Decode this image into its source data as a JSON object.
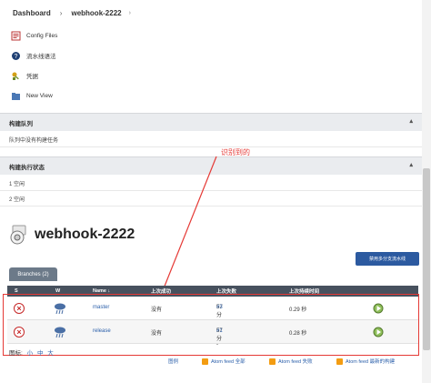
{
  "breadcrumb": {
    "home": "Dashboard",
    "sep": "›",
    "project": "webhook-2222",
    "chevron": "›"
  },
  "sidebar": {
    "items": [
      {
        "label": "Config Files",
        "icon": "config-files-icon"
      },
      {
        "label": "流水线语法",
        "icon": "help-icon"
      },
      {
        "label": "凭据",
        "icon": "credentials-icon"
      },
      {
        "label": "New View",
        "icon": "folder-icon"
      }
    ]
  },
  "build_queue": {
    "title": "构建队列",
    "empty": "队列中没有构建任务"
  },
  "executors": {
    "title": "构建执行状态",
    "rows": [
      "1  空闲",
      "2  空闲"
    ]
  },
  "annotation": "识别到的",
  "project": {
    "title": "webhook-2222",
    "disable_label": "禁用多分支流水线"
  },
  "branches": {
    "tab_label": "Branches (2)",
    "headers": {
      "s": "S",
      "w": "W",
      "name": "Name ↓",
      "last_success": "上次成功",
      "last_failure": "上次失败",
      "last_duration": "上次持续时间"
    },
    "rows": [
      {
        "name": "master",
        "last_success": "没有",
        "last_failure": "57 分 - ",
        "failure_build": "#3",
        "duration": "0.29 秒"
      },
      {
        "name": "release",
        "last_success": "没有",
        "last_failure": "57 分 - ",
        "failure_build": "#1",
        "duration": "0.28 秒"
      }
    ]
  },
  "footer": {
    "icon_label": "图标:",
    "sizes": [
      "小",
      "中",
      "大"
    ],
    "legend": "图例",
    "feeds": [
      "Atom feed 全部",
      "Atom feed 失败",
      "Atom feed 最新的构建"
    ]
  },
  "colors": {
    "accent": "#2c5aa0",
    "annotation": "#e53935",
    "header": "#47515e"
  }
}
